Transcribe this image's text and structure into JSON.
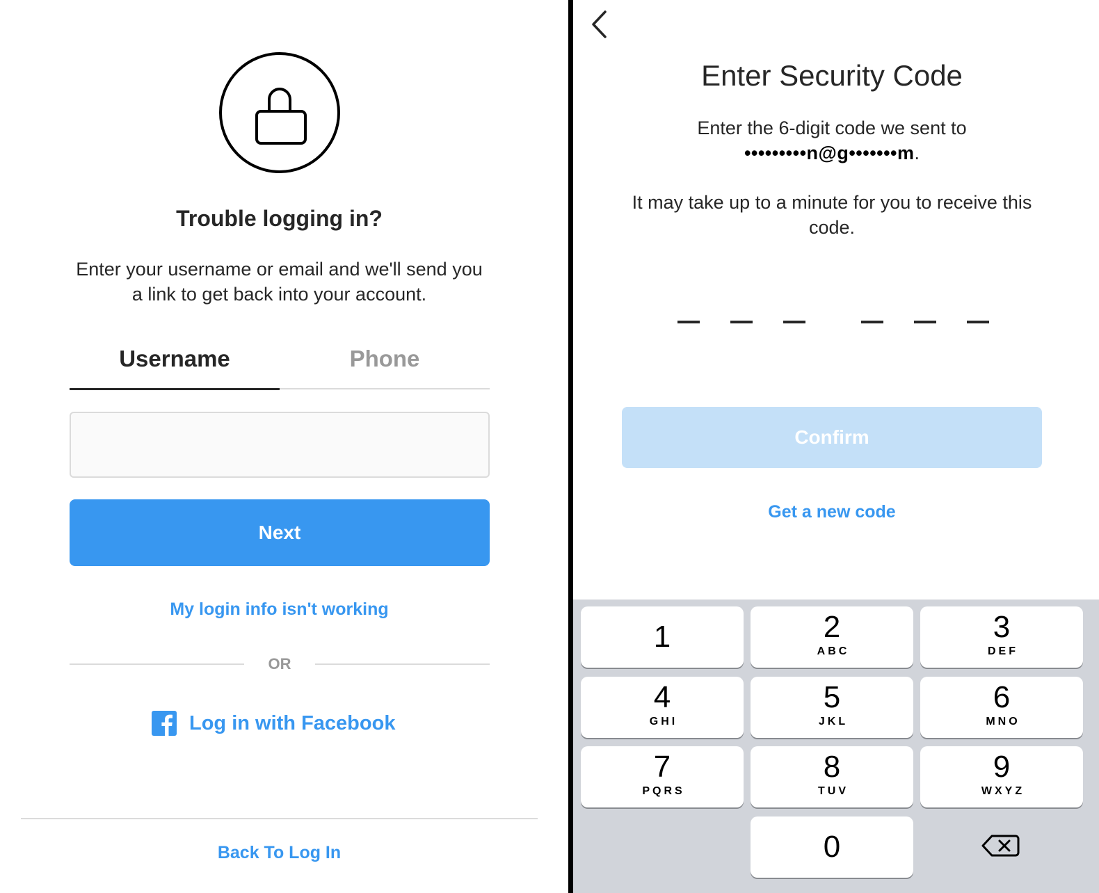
{
  "left_screen": {
    "icon": "lock-icon",
    "title": "Trouble logging in?",
    "description": "Enter your username or email and we'll send you a link to get back into your account.",
    "tabs": [
      {
        "label": "Username",
        "active": true
      },
      {
        "label": "Phone",
        "active": false
      }
    ],
    "username_input": {
      "value": "",
      "placeholder": ""
    },
    "next_button": "Next",
    "login_info_link": "My login info isn't working",
    "or_label": "OR",
    "facebook_link": {
      "icon": "facebook-icon",
      "label": "Log in with Facebook"
    },
    "back_to_login_link": "Back To Log In"
  },
  "right_screen": {
    "back_icon": "chevron-left-icon",
    "title": "Enter Security Code",
    "description_prefix": "Enter the 6-digit code we sent to",
    "masked_email": "•••••••••n@g•••••••m",
    "masked_email_suffix": ".",
    "wait_note": "It may take up to a minute for you to receive this code.",
    "code_digits": [
      "",
      "",
      "",
      "",
      "",
      ""
    ],
    "confirm_button": {
      "label": "Confirm",
      "enabled": false
    },
    "new_code_link": "Get a new code",
    "keypad": [
      {
        "num": "1",
        "letters": ""
      },
      {
        "num": "2",
        "letters": "ABC"
      },
      {
        "num": "3",
        "letters": "DEF"
      },
      {
        "num": "4",
        "letters": "GHI"
      },
      {
        "num": "5",
        "letters": "JKL"
      },
      {
        "num": "6",
        "letters": "MNO"
      },
      {
        "num": "7",
        "letters": "PQRS"
      },
      {
        "num": "8",
        "letters": "TUV"
      },
      {
        "num": "9",
        "letters": "WXYZ"
      },
      {
        "num": "0",
        "letters": ""
      }
    ],
    "delete_key_icon": "backspace-icon"
  },
  "colors": {
    "accent_blue": "#3897f0",
    "disabled_blue": "#c4e0f8",
    "keyboard_bg": "#d1d4da",
    "text_dark": "#262626",
    "text_muted": "#999999",
    "divider": "#dbdbdb"
  }
}
